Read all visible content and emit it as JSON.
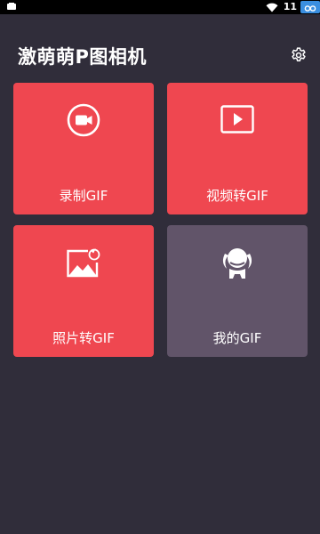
{
  "status_bar": {
    "battery_level": "11",
    "wifi_icon": "wifi-icon",
    "cloud_icon": "cloud-icon"
  },
  "header": {
    "title": "激萌萌P图相机",
    "settings_icon": "gear-icon"
  },
  "tiles": [
    {
      "label": "录制GIF",
      "icon": "video-camera-icon",
      "color": "#ef4750"
    },
    {
      "label": "视频转GIF",
      "icon": "play-icon",
      "color": "#ef4750"
    },
    {
      "label": "照片转GIF",
      "icon": "photo-convert-icon",
      "color": "#ef4750"
    },
    {
      "label": "我的GIF",
      "icon": "character-icon",
      "color": "#615469"
    }
  ],
  "colors": {
    "background": "#302d3a",
    "accent_red": "#ef4750",
    "tile_purple": "#615469"
  }
}
